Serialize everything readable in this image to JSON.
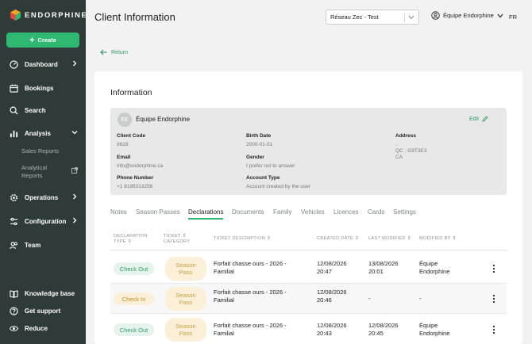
{
  "sidebar": {
    "brand": "ENDORPHINE",
    "create_label": "Create",
    "items": [
      {
        "label": "Dashboard"
      },
      {
        "label": "Bookings"
      },
      {
        "label": "Search"
      },
      {
        "label": "Analysis"
      },
      {
        "label": "Operations"
      },
      {
        "label": "Configuration"
      },
      {
        "label": "Team"
      }
    ],
    "analysis_sub": [
      "Sales Reports",
      "Analytical Reports"
    ],
    "bottom": [
      {
        "label": "Knowledge base"
      },
      {
        "label": "Get support"
      },
      {
        "label": "Reduce"
      }
    ]
  },
  "header": {
    "title": "Client Information",
    "network_select": "Réseau Zec - Test",
    "user": "Équipe Endorphine",
    "language": "FR"
  },
  "return_label": "Return",
  "info": {
    "section_title": "Information",
    "avatar_initials": "EE",
    "name": "Équipe Endorphine",
    "edit_label": "Edit",
    "fields": {
      "client_code": {
        "label": "Client Code",
        "value": "9628"
      },
      "birth_date": {
        "label": "Birth Date",
        "value": "2000-01-01"
      },
      "address": {
        "label": "Address",
        "line1": ",",
        "line2": "QC , G9T3E3",
        "line3": "CA"
      },
      "email": {
        "label": "Email",
        "value": "info@endorphine.ca"
      },
      "gender": {
        "label": "Gender",
        "value": "I prefer not to answer"
      },
      "phone": {
        "label": "Phone Number",
        "value": "+1 8195313256"
      },
      "account_type": {
        "label": "Account Type",
        "value": "Account created by the user"
      }
    }
  },
  "tabs": [
    "Notes",
    "Season Passes",
    "Declarations",
    "Documents",
    "Family",
    "Vehicles",
    "Licences",
    "Cards",
    "Settings"
  ],
  "active_tab": "Declarations",
  "table": {
    "columns": {
      "type": [
        "DECLARATION",
        "TYPE"
      ],
      "category": [
        "TICKET",
        "CATEGORY"
      ],
      "description": "TICKET DESCRIPTION",
      "created": "CREATED DATE",
      "modified": "LAST MODIFIED",
      "modified_by": "MODIFIED BY"
    },
    "rows": [
      {
        "type": "Check Out",
        "category": [
          "Season",
          "Pass"
        ],
        "description": [
          "Forfait chasse ours - 2026 -",
          "Familial"
        ],
        "created": [
          "12/08/2026",
          "20:47"
        ],
        "modified": [
          "13/08/2026",
          "20:01"
        ],
        "modified_by": [
          "Équipe",
          "Endorphine"
        ]
      },
      {
        "type": "Check In",
        "category": [
          "Season",
          "Pass"
        ],
        "description": [
          "Forfait chasse ours - 2026 -",
          "Familial"
        ],
        "created": [
          "12/08/2026",
          "20:46"
        ],
        "modified": [
          "-",
          ""
        ],
        "modified_by": [
          "-",
          ""
        ]
      },
      {
        "type": "Check Out",
        "category": [
          "Season",
          "Pass"
        ],
        "description": [
          "Forfait chasse ours - 2026 -",
          "Familial"
        ],
        "created": [
          "12/08/2026",
          "20:43"
        ],
        "modified": [
          "12/08/2026",
          "20:45"
        ],
        "modified_by": [
          "Équipe",
          "Endorphine"
        ]
      }
    ]
  },
  "colors": {
    "sidebar_bg": "#2f3b38",
    "accent_green": "#2eb872",
    "link_green": "#2e9e66",
    "check_in_orange": "#c38a2a",
    "season_pass_bg": "#fbefd8"
  }
}
